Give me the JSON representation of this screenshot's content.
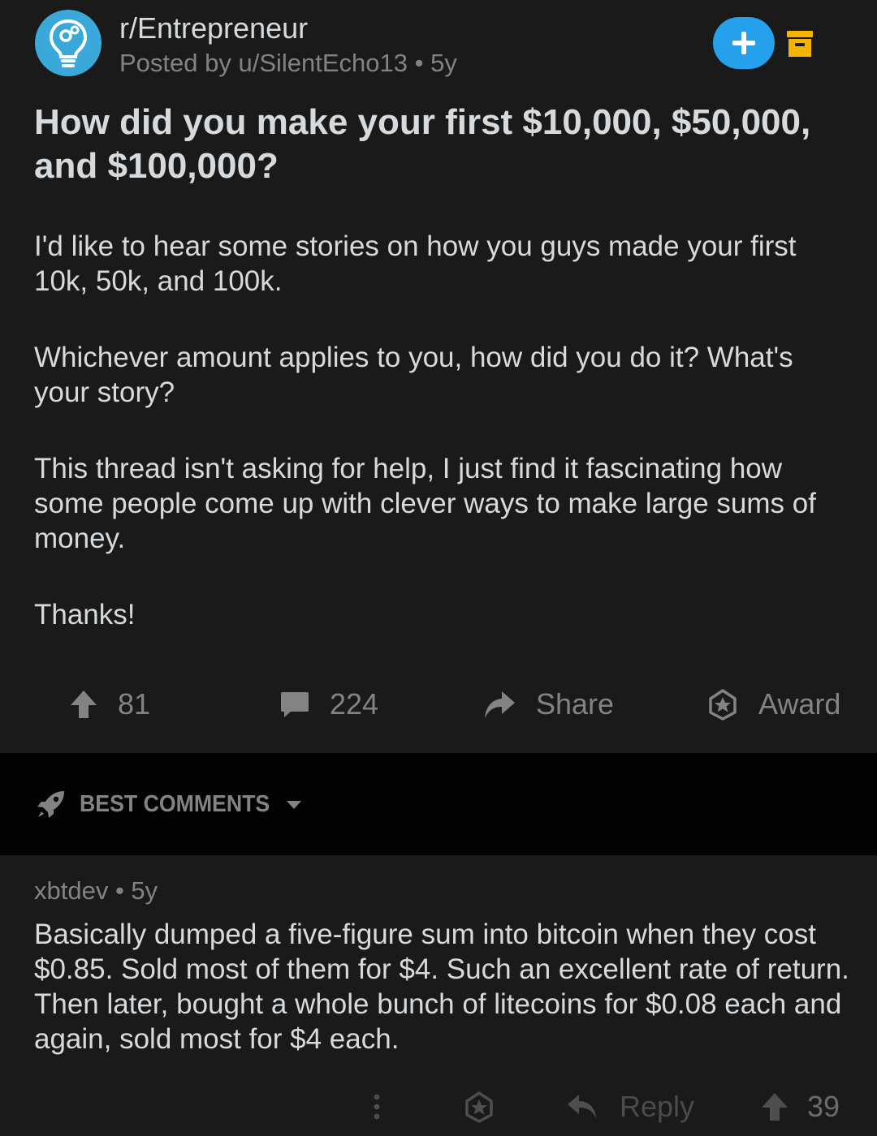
{
  "colors": {
    "page_bg": "#1a1a1b",
    "sort_bar_bg": "#030303",
    "text_primary": "#d7dadc",
    "text_meta": "#818384",
    "subreddit_icon_bg": "#3aa9d9",
    "join_button_bg": "#24a0ed",
    "save_icon": "#f4b400"
  },
  "post": {
    "subreddit": "r/Entrepreneur",
    "meta": "Posted by u/SilentEcho13 • 5y",
    "subreddit_icon": "lightbulb-gear-icon",
    "join_icon": "plus-icon",
    "save_icon": "save-box-icon",
    "title": "How did you make your first $10,000, $50,000, and $100,000?",
    "body": [
      "I'd like to hear some stories on how you guys made your first 10k, 50k, and 100k.",
      "Whichever amount applies to you, how did you do it? What's your story?",
      "This thread isn't asking for help, I just find it fascinating how some people come up with clever ways to make large sums of money.",
      "Thanks!"
    ],
    "actions": {
      "upvotes": "81",
      "comments": "224",
      "share": "Share",
      "award": "Award"
    }
  },
  "sort": {
    "label": "BEST COMMENTS",
    "icon": "rocket-icon"
  },
  "comment": {
    "author": "xbtdev",
    "age": "5y",
    "meta": "xbtdev • 5y",
    "body": "Basically dumped a five-figure sum into bitcoin when they cost $0.85. Sold most of them for $4. Such an excellent rate of return. Then later, bought a whole bunch of litecoins for $0.08 each and again, sold most for $4 each.",
    "actions": {
      "more": "⋮",
      "reply": "Reply",
      "votes": "39"
    }
  }
}
